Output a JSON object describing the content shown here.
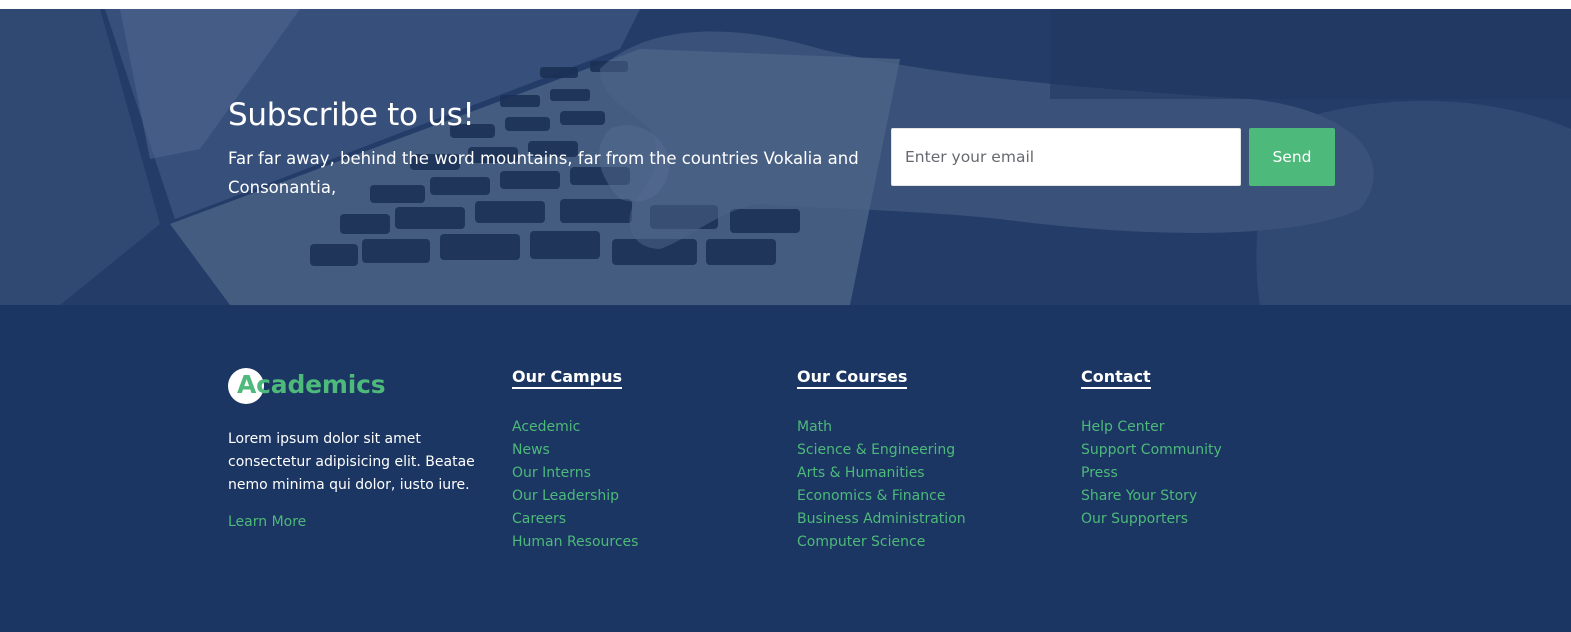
{
  "subscribe": {
    "title": "Subscribe to us!",
    "text": "Far far away, behind the word mountains, far from the countries Vokalia and Consonantia,",
    "email_placeholder": "Enter your email",
    "send_label": "Send"
  },
  "footer": {
    "logo_text": "Academics",
    "about_text": "Lorem ipsum dolor sit amet consectetur adipisicing elit. Beatae nemo minima qui dolor, iusto iure.",
    "learn_more": "Learn More",
    "columns": [
      {
        "heading": "Our Campus",
        "links": [
          "Acedemic",
          "News",
          "Our Interns",
          "Our Leadership",
          "Careers",
          "Human Resources"
        ]
      },
      {
        "heading": "Our Courses",
        "links": [
          "Math",
          "Science & Engineering",
          "Arts & Humanities",
          "Economics & Finance",
          "Business Administration",
          "Computer Science"
        ]
      },
      {
        "heading": "Contact",
        "links": [
          "Help Center",
          "Support Community",
          "Press",
          "Share Your Story",
          "Our Supporters"
        ]
      }
    ]
  },
  "colors": {
    "accent": "#4db97a",
    "footer_bg": "#1b3662",
    "subscribe_overlay": "#2a3d63"
  }
}
